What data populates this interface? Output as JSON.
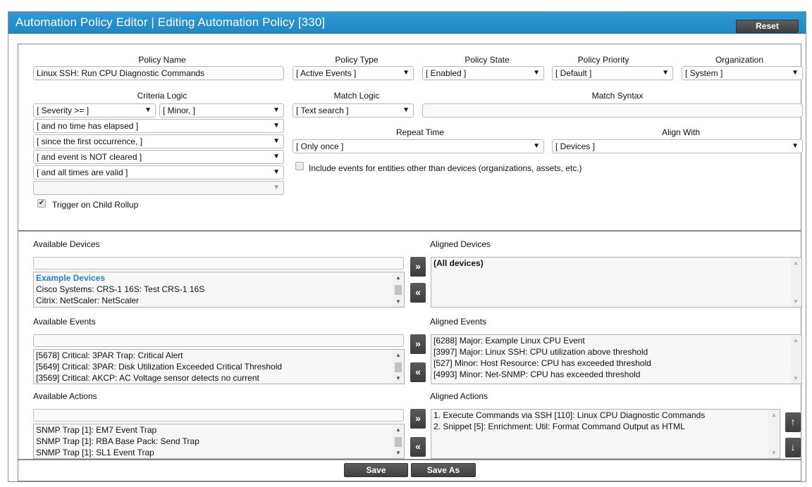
{
  "window": {
    "title": "Automation Policy Editor | Editing Automation Policy [330]",
    "reset_label": "Reset"
  },
  "policy": {
    "name_label": "Policy Name",
    "name_value": "Linux SSH: Run CPU Diagnostic Commands",
    "type_label": "Policy Type",
    "type_value": "[ Active Events ]",
    "state_label": "Policy State",
    "state_value": "[ Enabled ]",
    "priority_label": "Policy Priority",
    "priority_value": "[ Default ]",
    "org_label": "Organization",
    "org_value": "[ System ]"
  },
  "criteria": {
    "label": "Criteria Logic",
    "severity_op": "[ Severity >= ]",
    "severity_value": "[ Minor, ]",
    "time_elapsed": "[ and no time has elapsed ]",
    "since": "[ since the first occurrence, ]",
    "cleared": "[ and event is NOT cleared ]",
    "times_valid": "[ and all times are valid ]",
    "extra": "",
    "trigger_label": "Trigger on Child Rollup",
    "trigger_checked": true
  },
  "match": {
    "logic_label": "Match Logic",
    "logic_value": "[ Text search ]",
    "syntax_label": "Match Syntax",
    "syntax_value": ""
  },
  "repeat": {
    "label": "Repeat Time",
    "value": "[ Only once ]"
  },
  "align": {
    "label": "Align With",
    "value": "[ Devices ]"
  },
  "include_entities": {
    "label": "Include events for entities other than devices (organizations, assets, etc.)",
    "checked": false
  },
  "devices": {
    "available_label": "Available Devices",
    "aligned_label": "Aligned Devices",
    "search_value": "",
    "available": [
      {
        "text": "Example Devices",
        "group": true
      },
      {
        "text": "Cisco Systems: CRS-1 16S: Test CRS-1 16S",
        "group": false
      },
      {
        "text": "Citrix: NetScaler: NetScaler",
        "group": false
      }
    ],
    "aligned": [
      "(All devices)"
    ]
  },
  "events": {
    "available_label": "Available Events",
    "aligned_label": "Aligned Events",
    "search_value": "",
    "available": [
      "[5678] Critical: 3PAR Trap: Critical Alert",
      "[5649] Critical: 3PAR: Disk Utilization Exceeded Critical Threshold",
      "[3569] Critical: AKCP: AC Voltage sensor detects no current"
    ],
    "aligned": [
      "[6288] Major: Example Linux CPU Event",
      "[3997] Major: Linux SSH: CPU utilization above threshold",
      "[527] Minor: Host Resource: CPU has exceeded threshold",
      "[4993] Minor: Net-SNMP: CPU has exceeded threshold"
    ]
  },
  "actions": {
    "available_label": "Available Actions",
    "aligned_label": "Aligned Actions",
    "search_value": "",
    "available": [
      "SNMP Trap [1]: EM7 Event Trap",
      "SNMP Trap [1]: RBA Base Pack: Send Trap",
      "SNMP Trap [1]: SL1 Event Trap"
    ],
    "aligned": [
      "1. Execute Commands via SSH [110]: Linux CPU Diagnostic Commands",
      "2. Snippet [5]: Enrichment: Util: Format Command Output as HTML"
    ]
  },
  "icons": {
    "add": "»",
    "remove": "«",
    "move_up": "↑",
    "move_down": "↓",
    "dropdown": "▼",
    "check": "✔"
  },
  "footer": {
    "save_label": "Save",
    "save_as_label": "Save As"
  },
  "colors": {
    "title_bar": "#2288c6",
    "group_text": "#2a7fc1",
    "button_dark": "#4a4a4a"
  }
}
